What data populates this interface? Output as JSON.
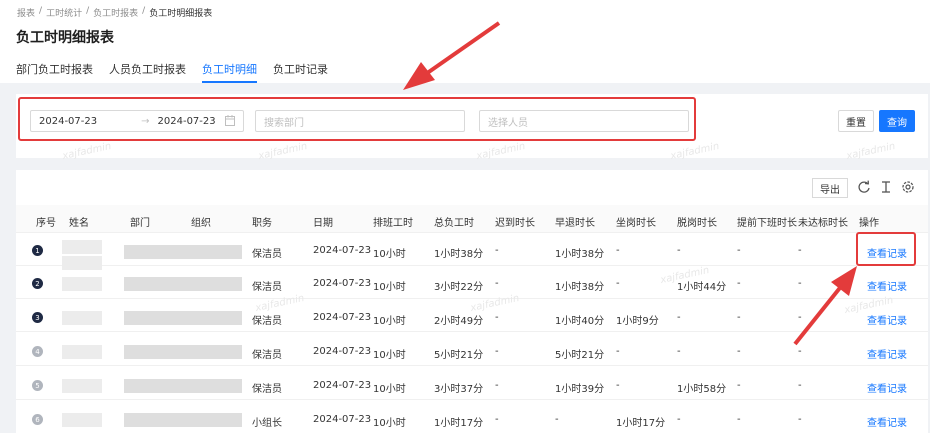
{
  "breadcrumb": [
    "报表",
    "工时统计",
    "负工时报表",
    "负工时明细报表"
  ],
  "page_title": "负工时明细报表",
  "tabs": [
    "部门负工时报表",
    "人员负工时报表",
    "负工时明细",
    "负工时记录"
  ],
  "active_tab": "负工时明细",
  "filters": {
    "date_start": "2024-07-23",
    "date_sep": "→",
    "date_end": "2024-07-23",
    "dept_placeholder": "搜索部门",
    "person_placeholder": "选择人员",
    "reset_label": "重置",
    "query_label": "查询"
  },
  "toolbar": {
    "export_label": "导出",
    "icons": [
      "refresh-icon",
      "column-height-icon",
      "settings-icon"
    ]
  },
  "columns": [
    "序号",
    "姓名",
    "部门",
    "组织",
    "职务",
    "日期",
    "排班工时",
    "总负工时",
    "迟到时长",
    "早退时长",
    "坐岗时长",
    "脱岗时长",
    "提前下班时长",
    "未达标时长",
    "操作"
  ],
  "rows": [
    {
      "idx": "1",
      "role": "保洁员",
      "date": "2024-07-23",
      "shift": "10小时",
      "total": "1小时38分",
      "late": "-",
      "early": "1小时38分",
      "seat": "-",
      "off": "-",
      "leave_early": "-",
      "unmet": "-",
      "action": "查看记录"
    },
    {
      "idx": "2",
      "role": "保洁员",
      "date": "2024-07-23",
      "shift": "10小时",
      "total": "3小时22分",
      "late": "-",
      "early": "1小时38分",
      "seat": "-",
      "off": "1小时44分",
      "leave_early": "-",
      "unmet": "-",
      "action": "查看记录"
    },
    {
      "idx": "3",
      "role": "保洁员",
      "date": "2024-07-23",
      "shift": "10小时",
      "total": "2小时49分",
      "late": "-",
      "early": "1小时40分",
      "seat": "1小时9分",
      "off": "-",
      "leave_early": "-",
      "unmet": "-",
      "action": "查看记录"
    },
    {
      "idx": "4",
      "role": "保洁员",
      "date": "2024-07-23",
      "shift": "10小时",
      "total": "5小时21分",
      "late": "-",
      "early": "5小时21分",
      "seat": "-",
      "off": "-",
      "leave_early": "-",
      "unmet": "-",
      "action": "查看记录"
    },
    {
      "idx": "5",
      "role": "保洁员",
      "date": "2024-07-23",
      "shift": "10小时",
      "total": "3小时37分",
      "late": "-",
      "early": "1小时39分",
      "seat": "-",
      "off": "1小时58分",
      "leave_early": "-",
      "unmet": "-",
      "action": "查看记录"
    },
    {
      "idx": "6",
      "role": "小组长",
      "date": "2024-07-23",
      "shift": "10小时",
      "total": "1小时17分",
      "late": "-",
      "early": "-",
      "seat": "1小时17分",
      "off": "-",
      "leave_early": "-",
      "unmet": "-",
      "action": "查看记录"
    }
  ],
  "watermark": "xajfadmin",
  "colors": {
    "primary": "#1677ff",
    "highlight": "#e33b3b",
    "index_dark": "#1f2a44",
    "index_light": "#b0b5bd"
  }
}
